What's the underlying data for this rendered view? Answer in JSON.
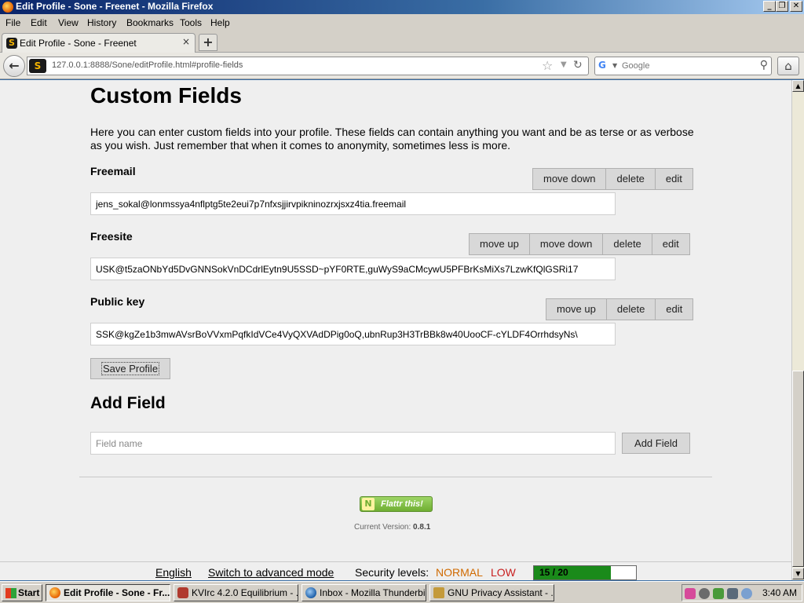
{
  "window": {
    "title": "Edit Profile - Sone - Freenet - Mozilla Firefox",
    "buttons": {
      "minimize": "_",
      "maximize": "❐",
      "close": "✕"
    }
  },
  "menu": [
    "File",
    "Edit",
    "View",
    "History",
    "Bookmarks",
    "Tools",
    "Help"
  ],
  "tab": {
    "title": "Edit Profile - Sone - Freenet",
    "close": "×",
    "new_tab": "+"
  },
  "nav": {
    "back": "←",
    "url": "127.0.0.1:8888/Sone/editProfile.html#profile-fields",
    "search_placeholder": "Google"
  },
  "page": {
    "heading": "Custom Fields",
    "intro": "Here you can enter custom fields into your profile. These fields can contain anything you want and be as terse or as verbose as you wish. Just remember that when it comes to anonymity, sometimes less is more.",
    "fields": [
      {
        "label": "Freemail",
        "value": "jens_sokal@lonmssya4nflptg5te2eui7p7nfxsjjirvpikninozrxjsxz4tia.freemail",
        "buttons": [
          "move down",
          "delete",
          "edit"
        ]
      },
      {
        "label": "Freesite",
        "value": "USK@t5zaONbYd5DvGNNSokVnDCdrlEytn9U5SSD~pYF0RTE,guWyS9aCMcywU5PFBrKsMiXs7LzwKfQlGSRi17",
        "buttons": [
          "move up",
          "move down",
          "delete",
          "edit"
        ]
      },
      {
        "label": "Public key",
        "value": "SSK@kgZe1b3mwAVsrBoVVxmPqfkIdVCe4VyQXVAdDPig0oQ,ubnRup3H3TrBBk8w40UooCF-cYLDF4OrrhdsyNs\\",
        "buttons": [
          "move up",
          "delete",
          "edit"
        ]
      }
    ],
    "save_button": "Save Profile",
    "add_heading": "Add Field",
    "add_placeholder": "Field name",
    "add_button": "Add Field",
    "flattr_label": "Flattr this!",
    "version_label": "Current Version:",
    "version_value": "0.8.1"
  },
  "statusbar": {
    "language": "English",
    "advanced_mode": "Switch to advanced mode",
    "security_label": "Security levels:",
    "security_network": "NORMAL",
    "security_friends": "LOW",
    "peers_text": "15 / 20",
    "peers_fraction": 0.75,
    "colors": {
      "normal": "#d06a00",
      "low": "#c81e1e",
      "bar": "#1a8a1a"
    }
  },
  "taskbar": {
    "start": "Start",
    "tasks": [
      {
        "label": "Edit Profile - Sone - Fr...",
        "icon": "firefox-icon",
        "active": true
      },
      {
        "label": "KVIrc 4.2.0 Equilibrium - ...",
        "icon": "kvirc-icon",
        "active": false
      },
      {
        "label": "Inbox - Mozilla Thunderbird",
        "icon": "thunderbird-icon",
        "active": false
      },
      {
        "label": "GNU Privacy Assistant - ...",
        "icon": "gpa-icon",
        "active": false
      }
    ],
    "clock": "3:40 AM"
  }
}
